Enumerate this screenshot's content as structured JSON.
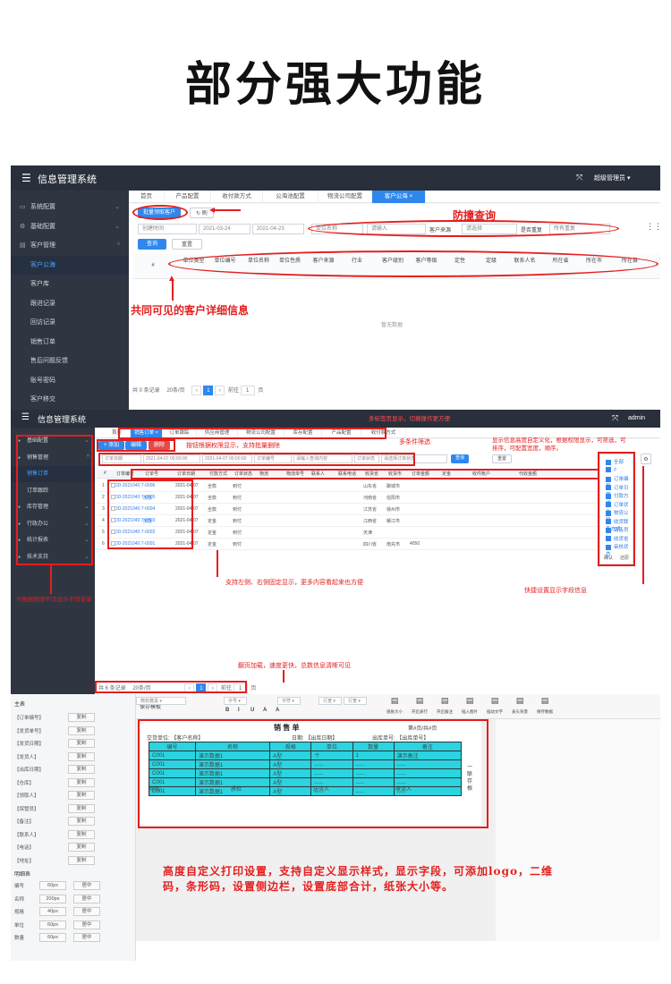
{
  "headline": "部分强大功能",
  "shot1": {
    "app_title": "信息管理系统",
    "user": "超级管理员 ▾",
    "sidebar": [
      {
        "icon": "monitor-icon",
        "label": "系统配置",
        "chevron": "⌄"
      },
      {
        "icon": "gear-icon",
        "label": "基础配置",
        "chevron": "⌄"
      },
      {
        "icon": "doc-icon",
        "label": "客户管理",
        "chevron": "^"
      },
      {
        "icon": "",
        "label": "客户公海",
        "chevron": ""
      },
      {
        "icon": "",
        "label": "客户库",
        "chevron": ""
      },
      {
        "icon": "",
        "label": "跟进记录",
        "chevron": ""
      },
      {
        "icon": "",
        "label": "回访记录",
        "chevron": ""
      },
      {
        "icon": "",
        "label": "销售订单",
        "chevron": ""
      },
      {
        "icon": "",
        "label": "售后问题反馈",
        "chevron": ""
      },
      {
        "icon": "",
        "label": "账号密码",
        "chevron": ""
      },
      {
        "icon": "",
        "label": "客户移交",
        "chevron": ""
      }
    ],
    "tabs": [
      "首页",
      "产品配置",
      "收付款方式",
      "公海池配置",
      "物流公司配置",
      "客户公海 ×"
    ],
    "btn_batch": "批量领取客户",
    "btn_refresh": "↻ 刷",
    "filter": {
      "create_time": "创建时间",
      "date_start": "2021-03-24",
      "date_end": "2021-04-23",
      "unit_name": "单位名称",
      "input_placeholder": "请输入",
      "customer_source": "客户来源",
      "select_placeholder": "请选择",
      "is_repeat": "是否重复",
      "repeat_placeholder": "所有重复"
    },
    "btn_query": "查询",
    "btn_reset": "重置",
    "columns": [
      "#",
      "单位类型",
      "单位编号",
      "单位名称",
      "单位性质",
      "客户来源",
      "行业",
      "客户级别",
      "客户等级",
      "定性",
      "定级",
      "联系人名",
      "所在省",
      "所在市",
      "所在县",
      "详细地址"
    ],
    "empty": "暂无数据",
    "pagination": {
      "total": "共 0 条记录",
      "size": "20条/页",
      "page": "1",
      "goto": "前往",
      "goto_page": "1",
      "unit": "页"
    },
    "anno_query": "防撞查询",
    "anno_info": "共同可见的客户详细信息"
  },
  "shot2": {
    "app_title": "信息管理系统",
    "user": "admin",
    "sidebar": [
      {
        "icon": "●",
        "label": "基础配置",
        "chevron": "⌄"
      },
      {
        "icon": "●",
        "label": "销售管理",
        "chevron": "^"
      },
      {
        "icon": "",
        "label": "销售订单",
        "chevron": ""
      },
      {
        "icon": "",
        "label": "订单跟踪",
        "chevron": ""
      },
      {
        "icon": "●",
        "label": "库存管理",
        "chevron": "⌄"
      },
      {
        "icon": "●",
        "label": "行政办公",
        "chevron": "⌄"
      },
      {
        "icon": "●",
        "label": "统计报表",
        "chevron": "⌄"
      },
      {
        "icon": "●",
        "label": "技术支持",
        "chevron": "⌄"
      }
    ],
    "tabs": [
      "首页",
      "销售订单 ×",
      "订单跟踪",
      "供应商管理",
      "物流公司配置",
      "库存配置",
      "产品配置",
      "收付款方式"
    ],
    "btn_add": "+ 添加",
    "btn_edit": "编辑",
    "btn_delete": "删除",
    "filter": [
      "订单日期",
      "2021-04-07 00:00:00",
      "2021-04-07 00:00:00",
      "订单编号",
      "请输入查询内容",
      "订单状态",
      "请选择订单状态",
      "查询",
      "重置"
    ],
    "columns": [
      "#",
      "订单编号",
      "订单号",
      "订单日期",
      "付款方式",
      "订单状态",
      "物流",
      "物流单号",
      "联系人",
      "联系电话",
      "收货省",
      "收货市",
      "订单金额",
      "定金",
      "收件账户",
      "代收金额"
    ],
    "rows": [
      [
        "1",
        "DD-2021040 7-0006",
        "",
        "2021-04-07",
        "全款",
        "到付",
        "",
        "",
        "",
        "",
        "山东省",
        "聊城市",
        "",
        "",
        "",
        ""
      ],
      [
        "2",
        "DD-2021040 7-0005",
        "加急",
        "2021-04-07",
        "全款",
        "到付",
        "",
        "",
        "",
        "",
        "河南省",
        "信阳市",
        "",
        "",
        "",
        ""
      ],
      [
        "3",
        "DD-2021040 7-0004",
        "",
        "2021-04-07",
        "全款",
        "到付",
        "",
        "",
        "",
        "",
        "江苏省",
        "徐州市",
        "",
        "",
        "",
        ""
      ],
      [
        "4",
        "DD-2021040 7-0003",
        "加急",
        "2021-04-07",
        "定金",
        "到付",
        "",
        "",
        "",
        "",
        "江西省",
        "赣江市",
        "",
        "",
        "",
        ""
      ],
      [
        "5",
        "DD-2021040 7-0002",
        "",
        "2021-04-07",
        "定金",
        "到付",
        "",
        "",
        "",
        "",
        "天津",
        "",
        "",
        "",
        "",
        ""
      ],
      [
        "6",
        "DD-2021040 7-0001",
        "",
        "2021-04-07",
        "定金",
        "到付",
        "",
        "",
        "",
        "",
        "四川省",
        "南充市",
        "4050",
        "",
        "",
        ""
      ]
    ],
    "column_options": [
      "全部",
      "#",
      "订单编号",
      "订单日期",
      "付款方式",
      "订单状态",
      "物流公司",
      "收货联系方式",
      "销售员",
      "收货省",
      "审核状态"
    ],
    "column_btn_ok": "确认",
    "column_btn_reset": "还原",
    "pagination": {
      "total": "共 6 条记录",
      "size": "20条/页",
      "page": "1",
      "goto": "前往",
      "goto_page": "1",
      "unit": "页"
    },
    "anno_tabs": "多标签页显示，切换操作更方便",
    "anno_perm": "按钮根据权限显示，支持批量删除",
    "anno_filter": "多条件筛选",
    "anno_custom": "显示信息高度自定义化，根据权限显示，可筛选，可排序，可配置宽度，顺序。",
    "anno_fixed": "支持左侧、右侧固定显示，更多内容看起来也方便",
    "anno_menu": "可根据权限不同显示不同菜单",
    "anno_fields": "快捷设置显示字段信息",
    "anno_paging": "翻页加载，速度更快，总数信息清晰可见"
  },
  "shot3": {
    "left_title": "主表",
    "left_rows": [
      "【订单编号】",
      "【发货单号】",
      "【发货日期】",
      "【发货人】",
      "【出库日期】",
      "【仓库】",
      "【领取人】",
      "【保管员】",
      "【备注】",
      "【联系人】",
      "【电话】",
      "【地址】"
    ],
    "copy_label": "复制",
    "detail_title": "明细表",
    "detail_rows": [
      [
        "编号",
        "60px",
        "居中"
      ],
      [
        "名称",
        "200px",
        "居中"
      ],
      [
        "规格",
        "40px",
        "居中"
      ],
      [
        "单位",
        "60px",
        "居中"
      ],
      [
        "数量",
        "60px",
        "居中"
      ]
    ],
    "toolbar_labels": [
      "保存模板",
      "微软雅黑",
      "字号",
      "字符",
      "行宽",
      "行宽"
    ],
    "format_buttons": [
      "B",
      "I",
      "U",
      "A",
      "A"
    ],
    "right_tools": [
      "纸张大小",
      "开启表行",
      "开启备注",
      "插入图片",
      "插动文字",
      "表头背景",
      "保存数据"
    ],
    "doc_title": "销 售 单",
    "doc_pages": "第#页/共#页",
    "doc_info": [
      "交货单位: 【客户名称】",
      "日期: 【出库日期】",
      "出库单号: 【出库单号】"
    ],
    "doc_header": [
      "编号",
      "名称",
      "规格",
      "单位",
      "数量",
      "备注"
    ],
    "doc_rows": [
      [
        "C001",
        "演示数据1",
        "A型",
        "个",
        "1",
        "演示备注"
      ],
      [
        "C001",
        "演示数据1",
        "A型",
        "......",
        "......",
        "......"
      ],
      [
        "C001",
        "演示数据1",
        "A型",
        "......",
        "......",
        "......"
      ],
      [
        "C001",
        "演示数据1",
        "A型",
        "......",
        "......",
        "......"
      ],
      [
        "C001",
        "演示数据1",
        "A型",
        "......",
        "......",
        "......"
      ]
    ],
    "doc_footer": [
      "制单:",
      "质检",
      "送货人",
      "收货人"
    ],
    "side_stamp": "一联存根",
    "caption": "高度自定义打印设置，支持自定义显示样式，显示字段，可添加logo，二维码，条形码，设置侧边栏，设置底部合计，纸张大小等。"
  }
}
